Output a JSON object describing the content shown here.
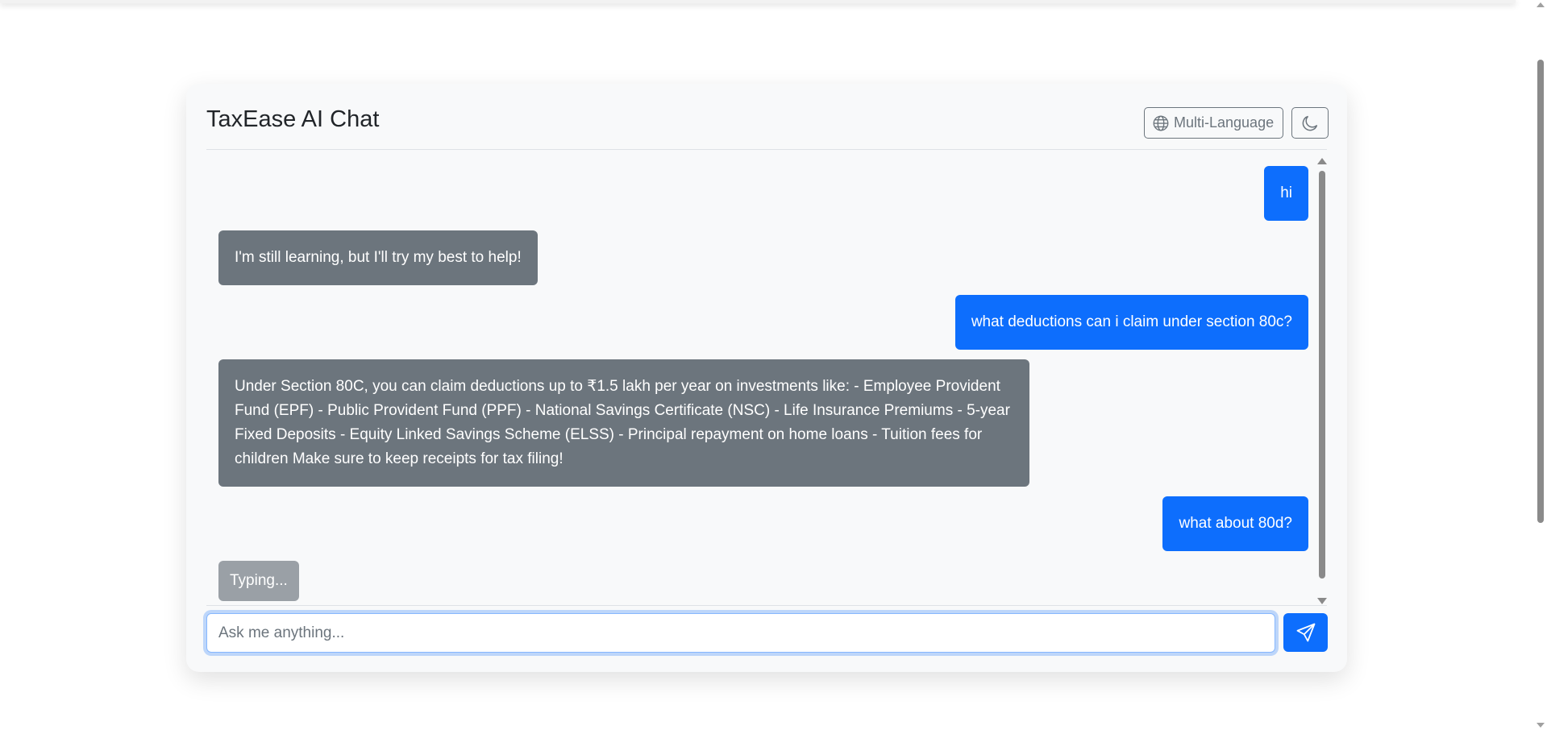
{
  "app": {
    "title": "TaxEase AI Chat"
  },
  "header": {
    "language_button_label": "Multi-Language",
    "language_icon": "globe-icon",
    "theme_icon": "moon-icon"
  },
  "messages": [
    {
      "role": "user",
      "text": "hi"
    },
    {
      "role": "bot",
      "text": "I'm still learning, but I'll try my best to help!"
    },
    {
      "role": "user",
      "text": "what deductions can i claim under section 80c?"
    },
    {
      "role": "bot",
      "text": "Under Section 80C, you can claim deductions up to ₹1.5 lakh per year on investments like: - Employee Provident Fund (EPF) - Public Provident Fund (PPF) - National Savings Certificate (NSC) - Life Insurance Premiums - 5-year Fixed Deposits - Equity Linked Savings Scheme (ELSS) - Principal repayment on home loans - Tuition fees for children Make sure to keep receipts for tax filing!"
    },
    {
      "role": "user",
      "text": "what about 80d?"
    }
  ],
  "typing_indicator": "Typing...",
  "composer": {
    "placeholder": "Ask me anything...",
    "value": "",
    "send_icon": "send-icon"
  },
  "colors": {
    "user_bubble": "#0d6efd",
    "bot_bubble": "#6c757d",
    "typing_bubble": "#9aa0a6",
    "card_background": "#f8f9fa"
  }
}
